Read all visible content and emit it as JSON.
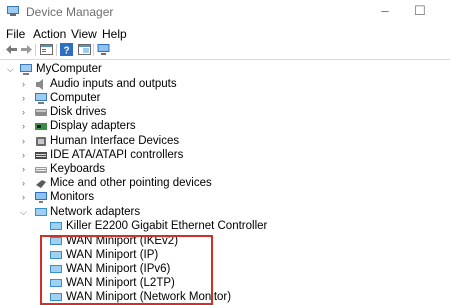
{
  "window": {
    "title": "Device Manager",
    "icon": "device-manager-icon"
  },
  "menu": [
    "File",
    "Action",
    "View",
    "Help"
  ],
  "toolbar": [
    "back-arrow-icon",
    "forward-arrow-icon",
    "properties-icon",
    "help-icon",
    "show-hidden-icon",
    "monitor-icon"
  ],
  "tree": {
    "root": "MyComputer",
    "categories": [
      {
        "label": "Audio inputs and outputs",
        "icon": "speaker-icon"
      },
      {
        "label": "Computer",
        "icon": "computer-icon"
      },
      {
        "label": "Disk drives",
        "icon": "disk-drive-icon"
      },
      {
        "label": "Display adapters",
        "icon": "display-adapter-icon"
      },
      {
        "label": "Human Interface Devices",
        "icon": "hid-icon"
      },
      {
        "label": "IDE ATA/ATAPI controllers",
        "icon": "ide-controller-icon"
      },
      {
        "label": "Keyboards",
        "icon": "keyboard-icon"
      },
      {
        "label": "Mice and other pointing devices",
        "icon": "mouse-icon"
      },
      {
        "label": "Monitors",
        "icon": "monitor-icon"
      },
      {
        "label": "Network adapters",
        "icon": "network-adapter-icon"
      }
    ],
    "network_children": [
      "Killer E2200 Gigabit Ethernet Controller",
      "WAN Miniport (IKEv2)",
      "WAN Miniport (IP)",
      "WAN Miniport (IPv6)",
      "WAN Miniport (L2TP)",
      "WAN Miniport (Network Monitor)"
    ]
  },
  "colors": {
    "highlight": "#d03028",
    "network_icon": "#3a8fc8"
  }
}
